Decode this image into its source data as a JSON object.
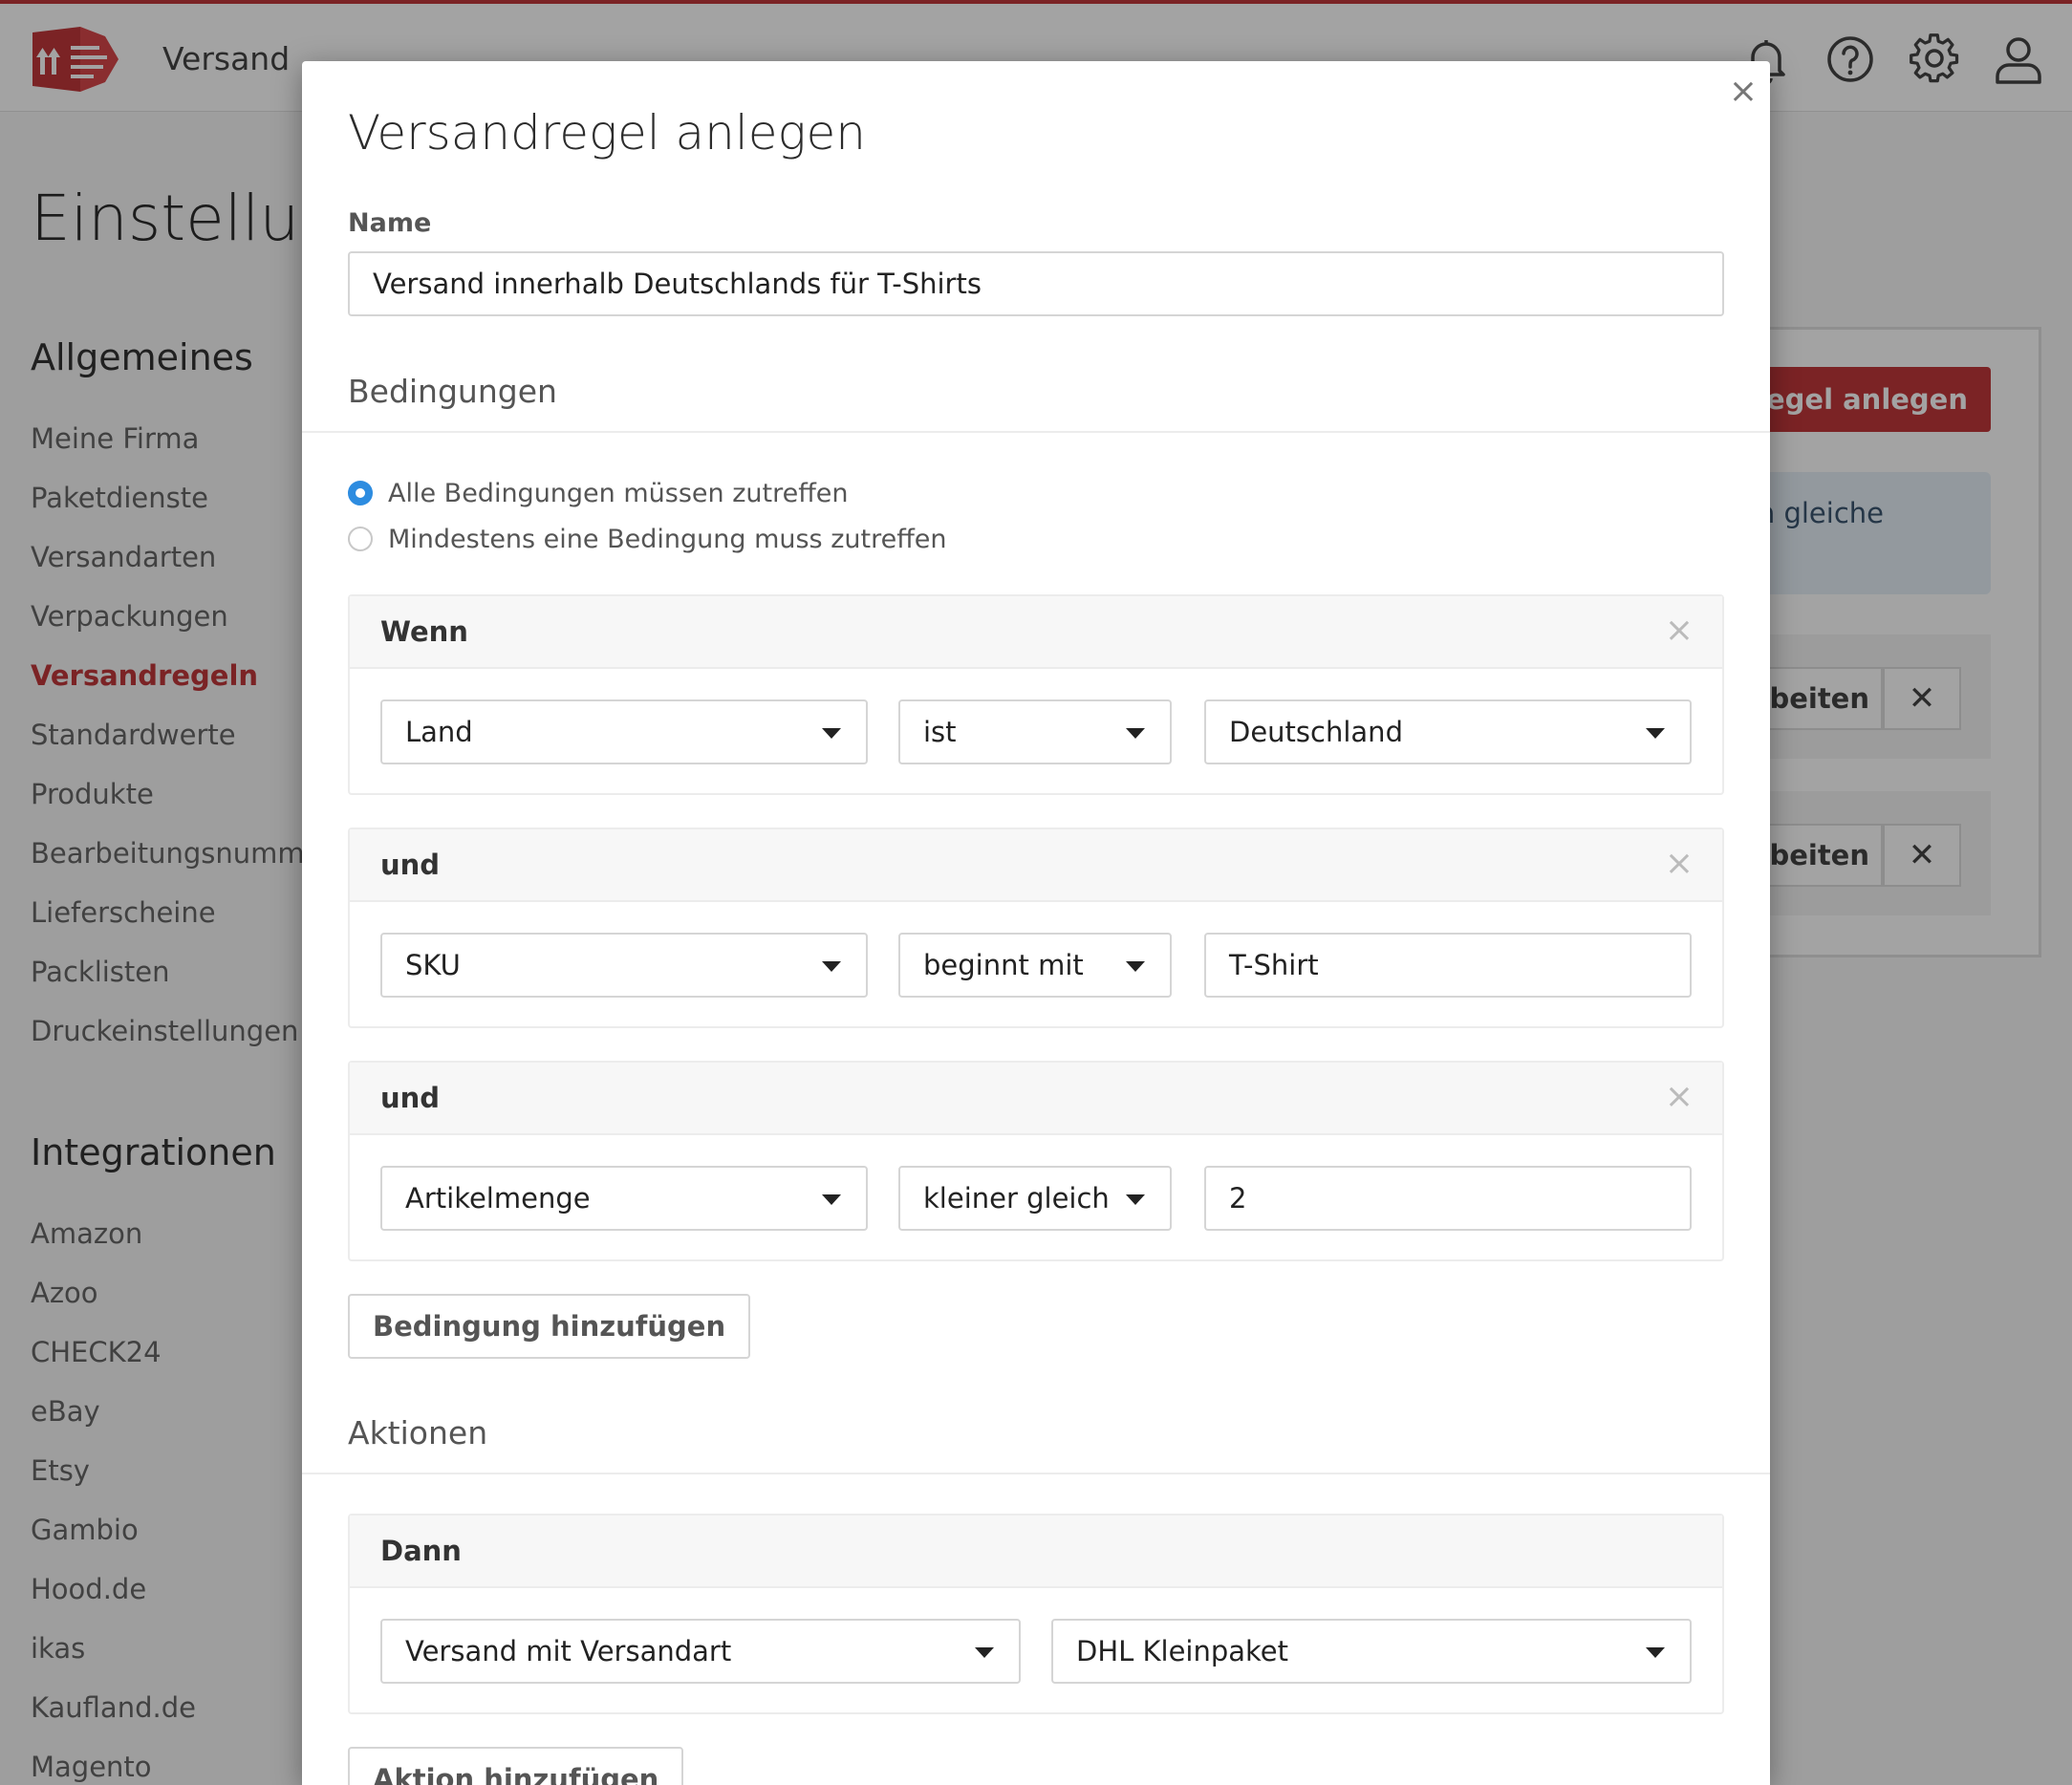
{
  "topbar": {
    "app_title": "Versand",
    "icons": [
      "logo-icon",
      "bell-icon",
      "help-icon",
      "gear-icon",
      "user-icon"
    ]
  },
  "background": {
    "page_title": "Einstellun",
    "general_heading": "Allgemeines",
    "general_items": [
      "Meine Firma",
      "Paketdienste",
      "Versandarten",
      "Verpackungen",
      "Versandregeln",
      "Standardwerte",
      "Produkte",
      "Bearbeitungsnummer",
      "Lieferscheine",
      "Packlisten",
      "Druckeinstellungen"
    ],
    "active_item": "Versandregeln",
    "integrations_heading": "Integrationen",
    "integration_items": [
      "Amazon",
      "Azoo",
      "CHECK24",
      "eBay",
      "Etsy",
      "Gambio",
      "Hood.de",
      "ikas",
      "Kaufland.de",
      "Magento"
    ],
    "create_button": "dregel anlegen",
    "info_text": "n gleiche",
    "edit_button": "beiten",
    "delete_button": "✕"
  },
  "modal": {
    "title": "Versandregel anlegen",
    "close_label": "×",
    "name_label": "Name",
    "name_value": "Versand innerhalb Deutschlands für T-Shirts",
    "conditions_title": "Bedingungen",
    "match_options": [
      {
        "label": "Alle Bedingungen müssen zutreffen",
        "selected": true
      },
      {
        "label": "Mindestens eine Bedingung muss zutreffen",
        "selected": false
      }
    ],
    "conditions": [
      {
        "connector": "Wenn",
        "field": "Land",
        "operator": "ist",
        "value": "Deutschland",
        "value_is_select": true
      },
      {
        "connector": "und",
        "field": "SKU",
        "operator": "beginnt mit",
        "value": "T-Shirt",
        "value_is_select": false
      },
      {
        "connector": "und",
        "field": "Artikelmenge",
        "operator": "kleiner gleich",
        "value": "2",
        "value_is_select": false
      }
    ],
    "remove_label": "×",
    "add_condition_label": "Bedingung hinzufügen",
    "actions_title": "Aktionen",
    "action": {
      "connector": "Dann",
      "type": "Versand mit Versandart",
      "value": "DHL Kleinpaket"
    },
    "add_action_label": "Aktion hinzufügen"
  },
  "colors": {
    "accent": "#c0373a",
    "radio_active": "#2d8ce0",
    "info_bg": "#e6f0f8"
  }
}
